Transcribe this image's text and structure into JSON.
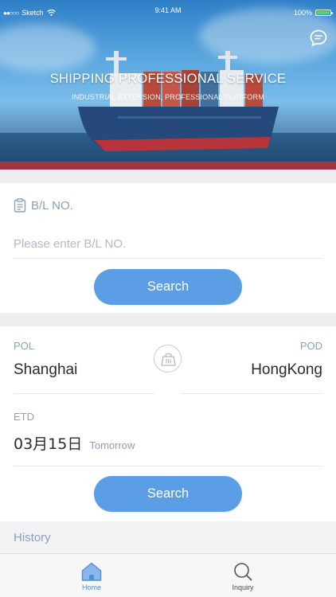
{
  "status_bar": {
    "carrier": "Sketch",
    "time": "9:41 AM",
    "battery": "100%"
  },
  "hero": {
    "title": "SHIPPING PROFESSIONAL SERVICE",
    "subtitle": "INDUSTRIAL EXTENSION, PROFESSIONAL PLATFORM"
  },
  "bl": {
    "label": "B/L NO.",
    "placeholder": "Please enter B/L NO.",
    "search_label": "Search"
  },
  "route": {
    "pol_label": "POL",
    "pol_value": "Shanghai",
    "pod_label": "POD",
    "pod_value": "HongKong",
    "etd_label": "ETD",
    "etd_value": "03月15日",
    "etd_hint": "Tomorrow",
    "search_label": "Search"
  },
  "history": {
    "label": "History"
  },
  "tabbar": {
    "home": "Home",
    "inquiry": "Inquiry"
  },
  "colors": {
    "accent": "#5b9ee6",
    "label": "#8aa0b8",
    "active_tab": "#4f8fd8"
  },
  "icons": [
    "chat-icon",
    "clipboard-icon",
    "container-icon",
    "home-icon",
    "search-icon",
    "wifi-icon",
    "battery-icon"
  ]
}
